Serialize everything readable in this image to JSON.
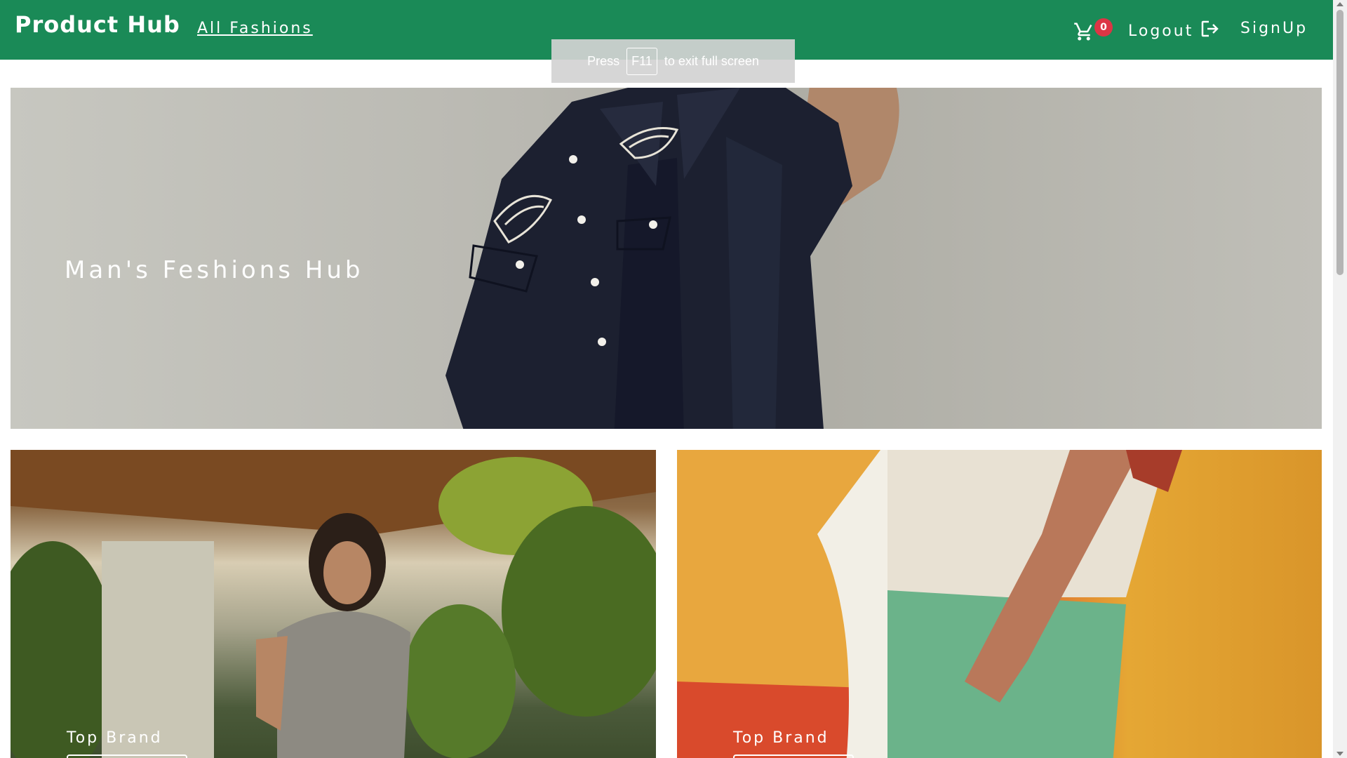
{
  "navbar": {
    "brand": "Product Hub",
    "all_fashions_link": "All Fashions",
    "cart_icon": "shopping-cart-icon",
    "cart_count": "0",
    "logout_label": "Logout",
    "logout_icon": "logout-arrow-icon",
    "signup_label": "SignUp"
  },
  "fullscreen_notice": {
    "prefix": "Press",
    "key": "F11",
    "suffix": "to exit full screen"
  },
  "hero": {
    "title": "Man's Feshions Hub"
  },
  "cards": [
    {
      "label": "Top Brand"
    },
    {
      "label": "Top Brand"
    }
  ],
  "colors": {
    "navbar_bg": "#1a8a57",
    "badge_bg": "#dc3545",
    "text_light": "#ffffff"
  }
}
